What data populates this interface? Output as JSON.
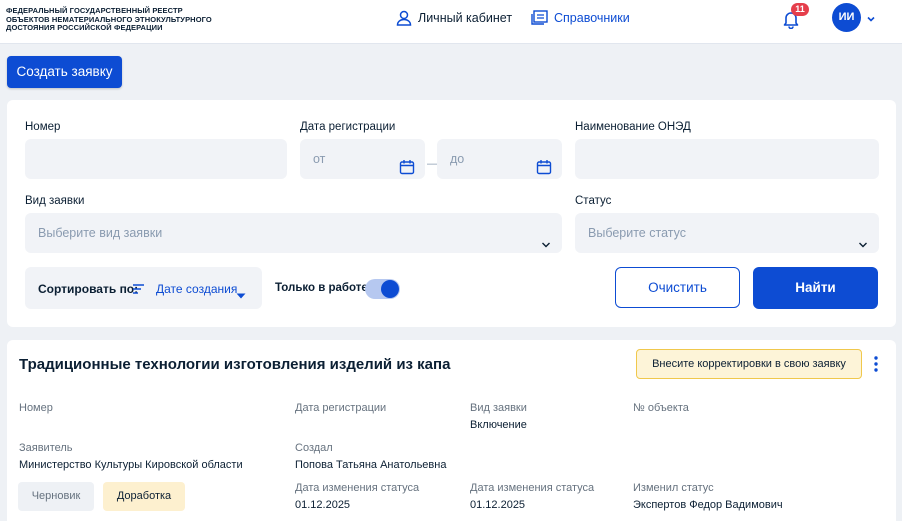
{
  "header": {
    "brand_lines": [
      "ФЕДЕРАЛЬНЫЙ ГОСУДАРСТВЕННЫЙ РЕЕСТР",
      "ОБЪЕКТОВ НЕМАТЕРИАЛЬНОГО ЭТНОКУЛЬТУРНОГО",
      "ДОСТОЯНИЯ РОССИЙСКОЙ ФЕДЕРАЦИИ"
    ],
    "nav": [
      {
        "label": "Личный кабинет",
        "icon": "user-icon"
      },
      {
        "label": "Справочники",
        "icon": "book-icon"
      }
    ],
    "notifications_count": "11",
    "avatar_initials": "ИИ"
  },
  "create_button": "Создать заявку",
  "filters": {
    "number_label": "Номер",
    "number_value": "",
    "reg_date_label": "Дата регистрации",
    "date_from_placeholder": "от",
    "date_to_placeholder": "до",
    "onezd_label": "Наименование ОНЭД",
    "onezd_value": "",
    "type_label": "Вид заявки",
    "type_placeholder": "Выберите вид заявки",
    "status_label": "Статус",
    "status_placeholder": "Выберите статус",
    "sort_label": "Сортировать по:",
    "sort_value": "Дате создания",
    "in_work_label": "Только в работе",
    "in_work_on": true,
    "clear_button": "Очистить",
    "find_button": "Найти"
  },
  "application": {
    "title": "Традиционные технологии изготовления изделий из капа",
    "warning": "Внесите корректировки в свою заявку",
    "number_label": "Номер",
    "number_value": "",
    "reg_date_label": "Дата регистрации",
    "reg_date_value": "",
    "type_label": "Вид заявки",
    "type_value": "Включение",
    "object_no_label": "№ объекта",
    "object_no_value": "",
    "applicant_label": "Заявитель",
    "applicant_value": "Министерство Культуры Кировской области",
    "created_by_label": "Создал",
    "created_by_value": "Попова Татьяна Анатольевна",
    "status_change_label_1": "Дата изменения статуса",
    "status_change_value_1": "01.12.2025",
    "status_change_label_2": "Дата изменения статуса",
    "status_change_value_2": "01.12.2025",
    "changed_by_label": "Изменил статус",
    "changed_by_value": "Экспертов Федор Вадимович",
    "chips": [
      "Черновик",
      "Доработка"
    ]
  },
  "colors": {
    "primary": "#0d4cd3",
    "badge": "#e53e4b",
    "warning_bg": "#fdf4d8",
    "warning_border": "#f0c84c",
    "field_bg": "#f1f3f7"
  }
}
